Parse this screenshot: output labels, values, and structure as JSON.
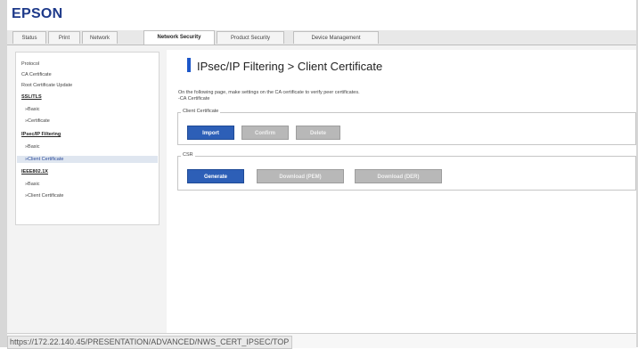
{
  "brand": {
    "logo": "EPSON",
    "logo_color": "#1e3a8a"
  },
  "tabs": [
    {
      "label": "Status",
      "active": false
    },
    {
      "label": "Print",
      "active": false
    },
    {
      "label": "Network",
      "active": false
    },
    {
      "label": "Network Security",
      "active": true
    },
    {
      "label": "Product Security",
      "active": false
    },
    {
      "label": "Device Management",
      "active": false
    }
  ],
  "sidebar": {
    "items": [
      {
        "label": "Protocol",
        "kind": "item"
      },
      {
        "label": "CA Certificate",
        "kind": "item"
      },
      {
        "label": "Root Certificate Update",
        "kind": "item"
      },
      {
        "label": "SSL/TLS",
        "kind": "heading"
      },
      {
        "label": "»Basic",
        "kind": "subitem"
      },
      {
        "label": "»Certificate",
        "kind": "subitem"
      },
      {
        "label": "IPsec/IP Filtering",
        "kind": "heading"
      },
      {
        "label": "»Basic",
        "kind": "subitem"
      },
      {
        "label": "»Client Certificate",
        "kind": "subitem-selected"
      },
      {
        "label": "IEEE802.1X",
        "kind": "heading"
      },
      {
        "label": "»Basic",
        "kind": "subitem"
      },
      {
        "label": "»Client Certificate",
        "kind": "subitem"
      }
    ]
  },
  "main": {
    "title": "IPsec/IP Filtering > Client Certificate",
    "description": "On the following page, make settings on the CA certificate to verify peer certificates.",
    "ca_link": "-CA Certificate",
    "client_certificate": {
      "legend": "Client Certificate",
      "buttons": {
        "import": "Import",
        "confirm": "Confirm",
        "delete": "Delete"
      }
    },
    "csr": {
      "legend": "CSR",
      "buttons": {
        "generate": "Generate",
        "download_pem": "Download (PEM)",
        "download_der": "Download (DER)"
      }
    }
  },
  "statusbar": {
    "url": "https://172.22.140.45/PRESENTATION/ADVANCED/NWS_CERT_IPSEC/TOP"
  },
  "colors": {
    "primary_button": "#2d5fb7",
    "accent_bar": "#1d57c9",
    "disabled_button": "#b8b8b8"
  }
}
